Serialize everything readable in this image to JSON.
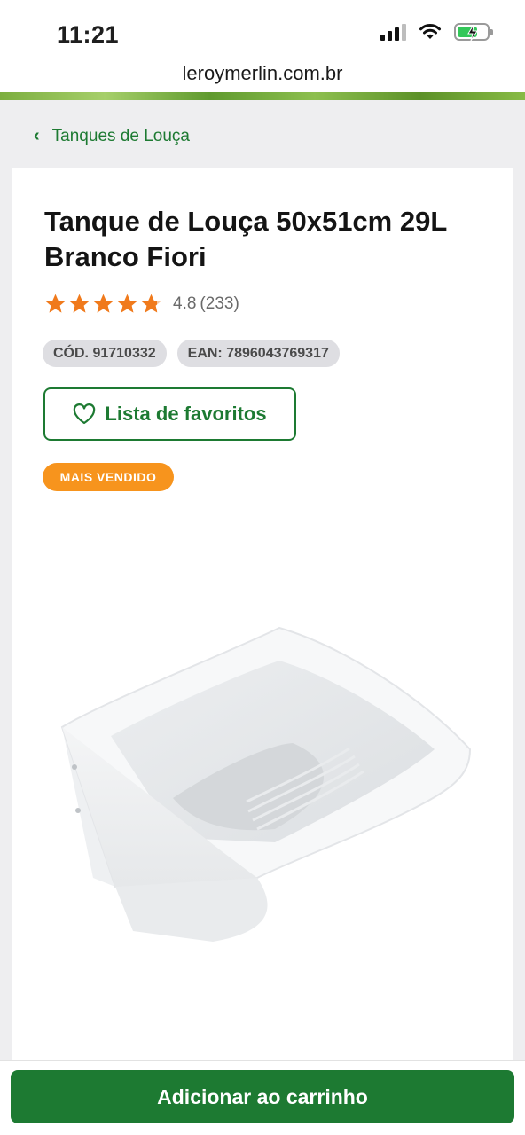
{
  "status_bar": {
    "time": "11:21"
  },
  "browser": {
    "url": "leroymerlin.com.br"
  },
  "breadcrumb": {
    "label": "Tanques de Louça"
  },
  "product": {
    "title": "Tanque de Louça 50x51cm 29L Branco Fiori",
    "rating": {
      "value": "4.8",
      "count": "(233)",
      "stars": 4.8
    },
    "codes": [
      "CÓD. 91710332",
      "EAN: 7896043769317"
    ],
    "favorite_label": "Lista de favoritos",
    "badge": "MAIS VENDIDO",
    "image_icon": "laundry-sink-image"
  },
  "cart": {
    "button_label": "Adicionar ao carrinho"
  },
  "colors": {
    "brand_green": "#1d7a32",
    "star_orange": "#f07a1c",
    "badge_orange": "#f7941d"
  }
}
